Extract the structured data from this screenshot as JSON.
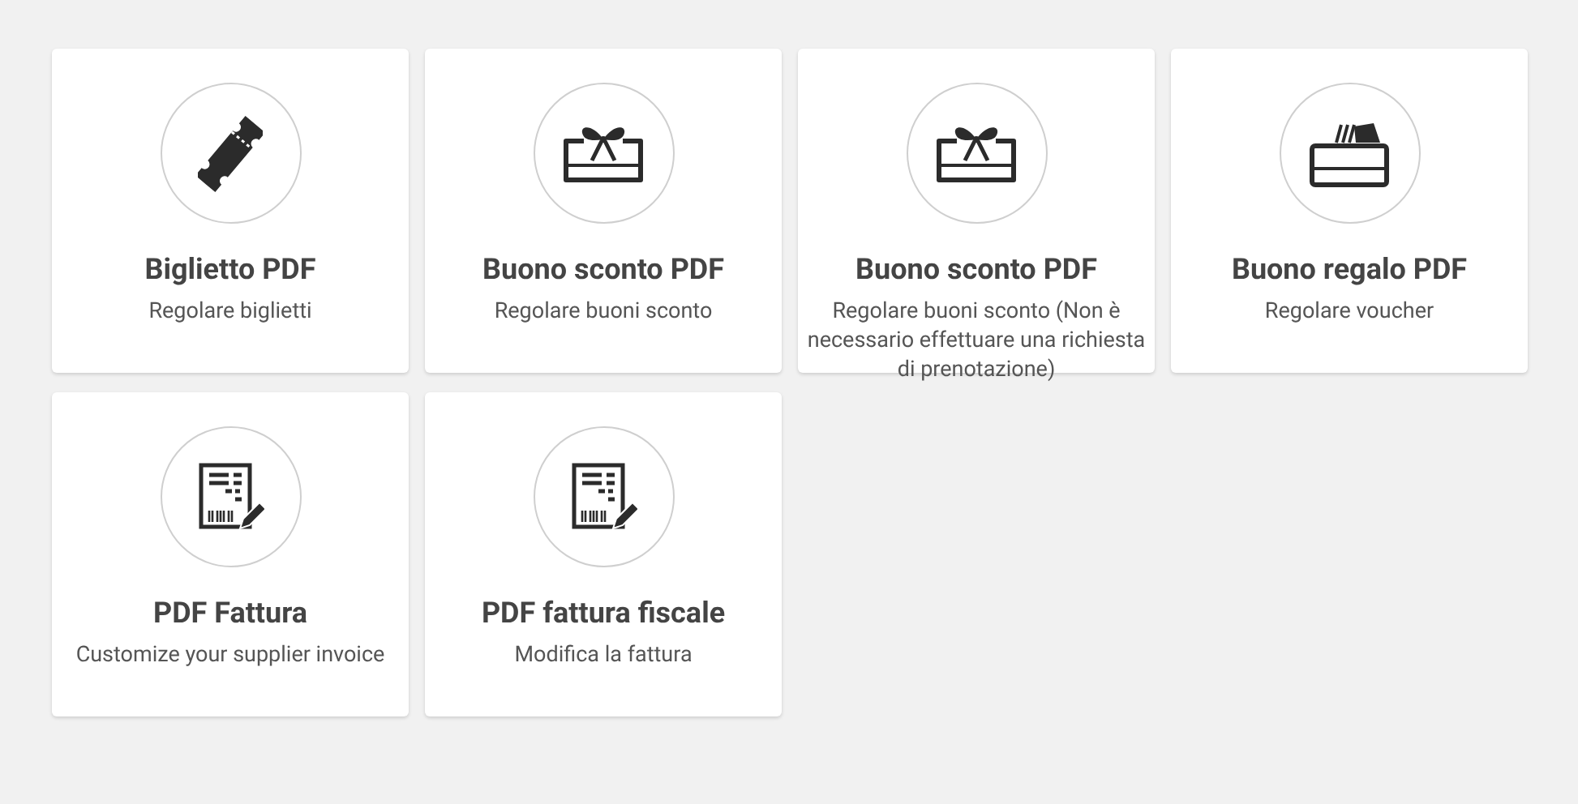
{
  "cards": [
    {
      "kind": "ticket",
      "title": "Biglietto PDF",
      "description": "Regolare biglietti"
    },
    {
      "kind": "gift-card",
      "title": "Buono sconto PDF",
      "description": "Regolare buoni sconto"
    },
    {
      "kind": "gift-card",
      "title": "Buono sconto PDF",
      "description": "Regolare buoni sconto (Non è necessario effettuare una richiesta di prenotazione)"
    },
    {
      "kind": "cash-card",
      "title": "Buono regalo PDF",
      "description": "Regolare voucher"
    },
    {
      "kind": "invoice",
      "title": "PDF Fattura",
      "description": "Customize your supplier invoice"
    },
    {
      "kind": "invoice",
      "title": "PDF fattura fiscale",
      "description": "Modifica la fattura"
    }
  ]
}
